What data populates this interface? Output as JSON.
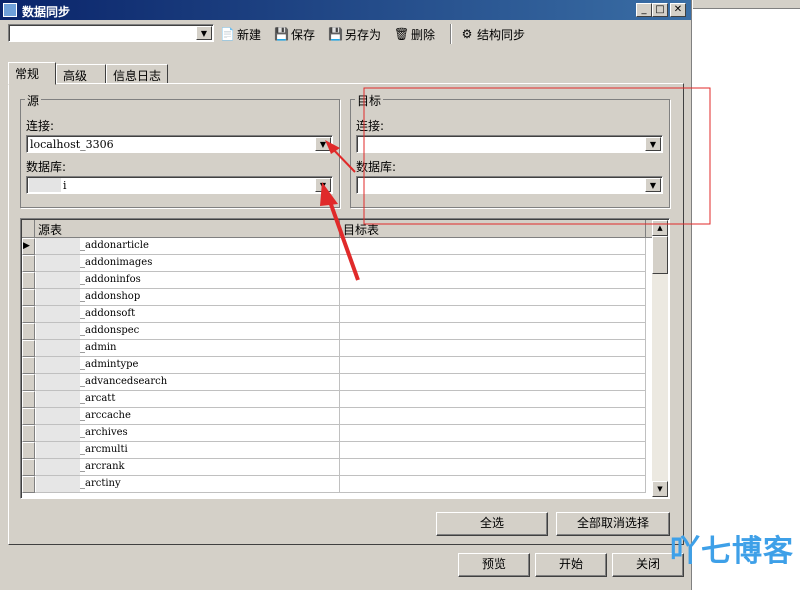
{
  "window": {
    "title": "数据同步",
    "controls": [
      "_",
      "□",
      "✕"
    ]
  },
  "toolbar": {
    "combo_value": "",
    "new_label": "新建",
    "save_label": "保存",
    "saveas_label": "另存为",
    "delete_label": "删除",
    "structsync_label": "结构同步"
  },
  "tabs": [
    "常规",
    "高级",
    "信息日志"
  ],
  "source": {
    "title": "源",
    "connection_label": "连接:",
    "connection_value": "localhost_3306",
    "database_label": "数据库:",
    "database_value": "i"
  },
  "target": {
    "title": "目标",
    "connection_label": "连接:",
    "connection_value": "",
    "database_label": "数据库:",
    "database_value": ""
  },
  "grid": {
    "columns": [
      "源表",
      "目标表"
    ],
    "rows": [
      "_addonarticle",
      "_addonimages",
      "_addoninfos",
      "_addonshop",
      "_addonsoft",
      "_addonspec",
      "_admin",
      "_admintype",
      "_advancedsearch",
      "_arcatt",
      "_arccache",
      "_archives",
      "_arcmulti",
      "_arcrank",
      "_arctiny"
    ]
  },
  "buttons": {
    "select_all": "全选",
    "deselect_all": "全部取消选择",
    "preview": "预览",
    "start": "开始",
    "close": "关闭"
  },
  "watermark": "吖七博客",
  "colors": {
    "annotation_red": "#e02a2a",
    "titlebar": "#0a246a",
    "watermark": "#3ea0e8"
  }
}
